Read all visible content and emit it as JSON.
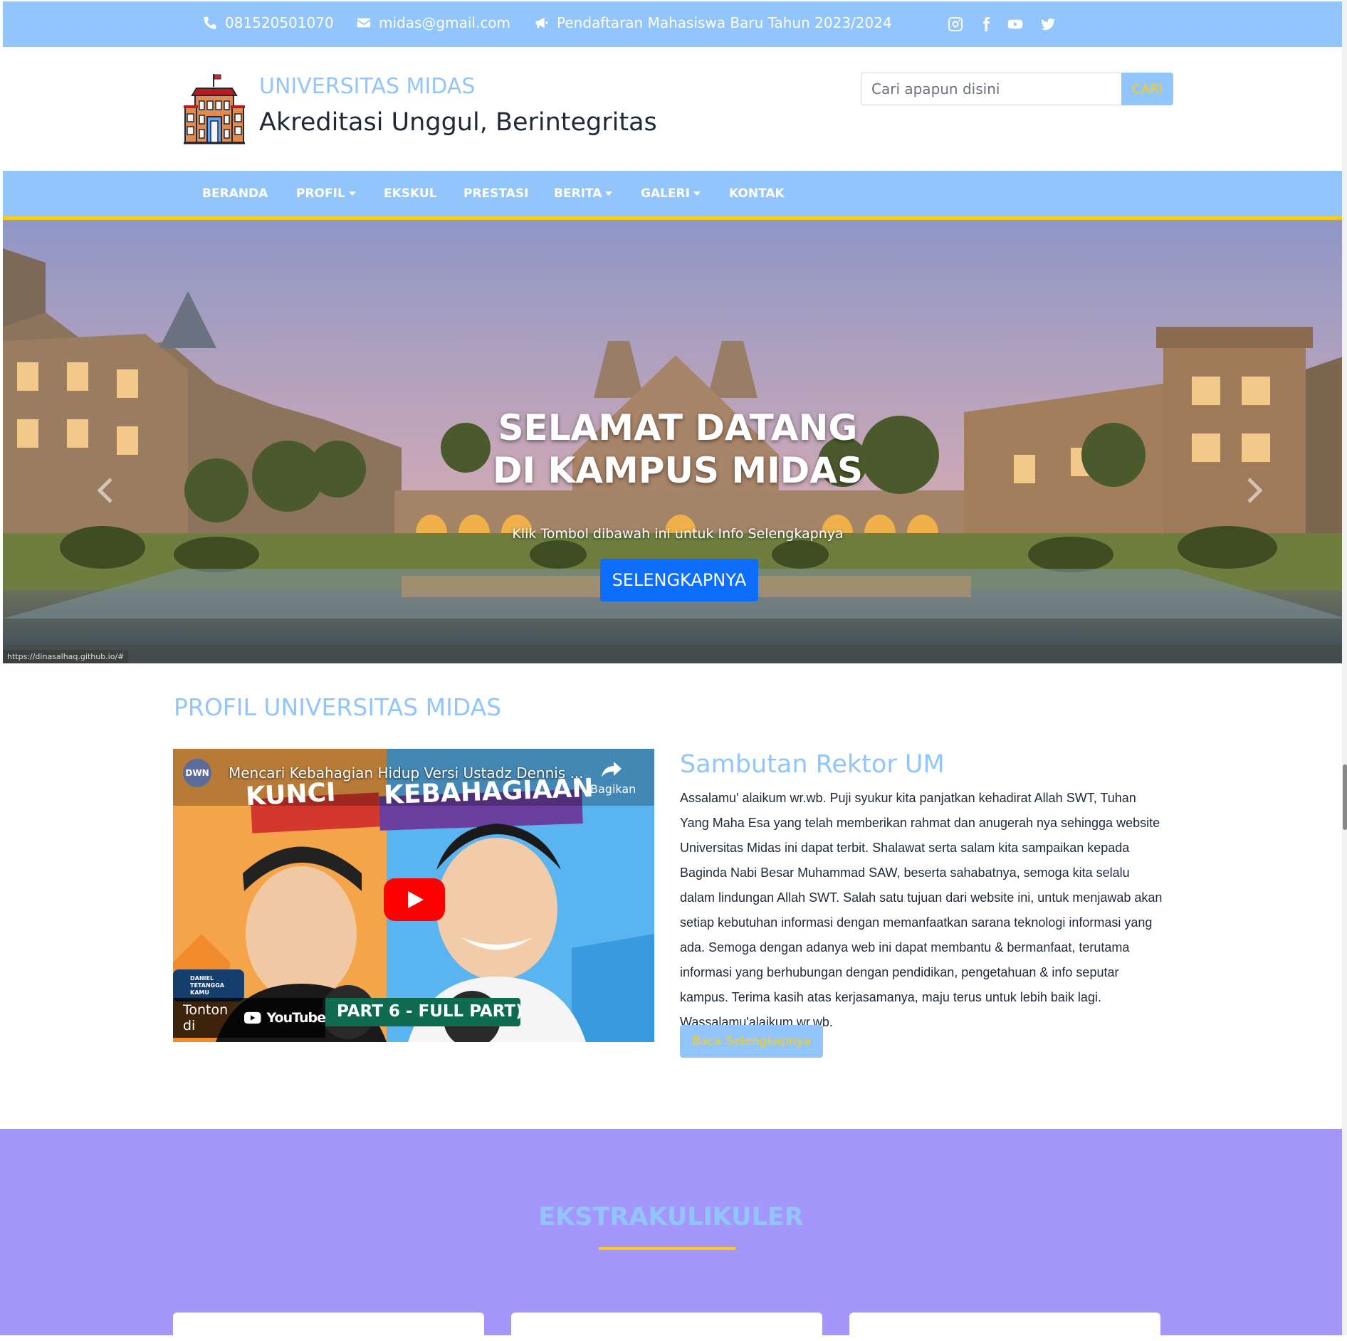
{
  "topbar": {
    "phone": "081520501070",
    "email": "midas@gmail.com",
    "announcement": "Pendaftaran Mahasiswa Baru Tahun 2023/2024",
    "social_icons": [
      "instagram-icon",
      "facebook-icon",
      "youtube-icon",
      "twitter-icon"
    ]
  },
  "header": {
    "brand": "UNIVERSITAS MIDAS",
    "tagline": "Akreditasi Unggul, Berintegritas",
    "search_placeholder": "Cari apapun disini",
    "search_button": "CARI"
  },
  "nav": {
    "items": [
      {
        "label": "BERANDA",
        "dropdown": false
      },
      {
        "label": "PROFIL",
        "dropdown": true
      },
      {
        "label": "EKSKUL",
        "dropdown": false
      },
      {
        "label": "PRESTASI",
        "dropdown": false
      },
      {
        "label": "BERITA",
        "dropdown": true
      },
      {
        "label": "GALERI",
        "dropdown": true
      },
      {
        "label": "KONTAK",
        "dropdown": false
      }
    ]
  },
  "hero": {
    "title_line1": "SELAMAT DATANG",
    "title_line2": "DI KAMPUS MIDAS",
    "subtitle": "Klik Tombol dibawah ini untuk Info Selengkapnya",
    "button": "SELENGKAPNYA",
    "status_url": "https://dinasalhaq.github.io/#"
  },
  "profile": {
    "section_title": "PROFIL UNIVERSITAS MIDAS",
    "video": {
      "title": "Mencari Kebahagian Hidup Versi Ustadz Dennis ...",
      "channel_badge": "DWN",
      "share_label": "Bagikan",
      "thumb_word1": "KUNCI",
      "thumb_word2": "KEBAHAGIAAN",
      "thumb_banner": "PART 6 - FULL PART)",
      "watch_on": "Tonton di",
      "youtube_label": "YouTube",
      "channel_name_line1": "DANIEL",
      "channel_name_line2": "TETANGGA",
      "channel_name_line3": "KAMU"
    },
    "rektor_title": "Sambutan Rektor UM",
    "rektor_text": "Assalamu' alaikum wr.wb. Puji syukur kita panjatkan kehadirat Allah SWT, Tuhan Yang Maha Esa yang telah memberikan rahmat dan anugerah nya sehingga website Universitas Midas ini dapat terbit. Shalawat serta salam kita sampaikan kepada Baginda Nabi Besar Muhammad SAW, beserta sahabatnya, semoga kita selalu dalam lindungan Allah SWT. Salah satu tujuan dari website ini, untuk menjawab akan setiap kebutuhan informasi dengan memanfaatkan sarana teknologi informasi yang ada. Semoga dengan adanya web ini dapat membantu & bermanfaat, terutama informasi yang berhubungan dengan pendidikan, pengetahuan & info seputar kampus. Terima kasih atas kerjasamanya, maju terus untuk lebih baik lagi. Wassalamu'alaikum wr.wb.",
    "read_more": "Baca Selengkapnya"
  },
  "ekskul": {
    "title": "EKSTRAKULIKULER"
  },
  "colors": {
    "primary": "#93c5fd",
    "accent": "#facc15",
    "button_blue": "#0d6efd",
    "ekskul_bg": "#a596fb"
  }
}
